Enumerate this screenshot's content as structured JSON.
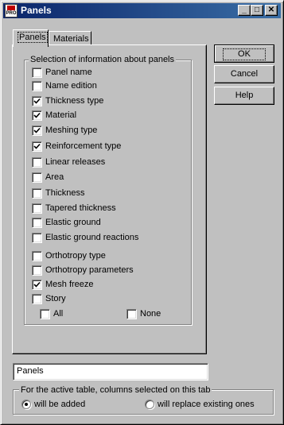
{
  "window": {
    "title": "Panels",
    "app_icon_text": "PRO",
    "minimize_glyph": "_",
    "maximize_glyph": "□",
    "close_glyph": "✕"
  },
  "tabs": [
    {
      "label": "Panels",
      "active": true
    },
    {
      "label": "Materials",
      "active": false
    }
  ],
  "selection_group": {
    "label": "Selection of information about panels",
    "items": [
      {
        "label": "Panel name",
        "checked": false
      },
      {
        "label": "Name edition",
        "checked": false
      },
      {
        "label": "Thickness type",
        "checked": true
      },
      {
        "label": "Material",
        "checked": true
      },
      {
        "label": "Meshing type",
        "checked": true
      },
      {
        "label": "Reinforcement type",
        "checked": true
      },
      {
        "label": "Linear releases",
        "checked": false
      },
      {
        "label": "Area",
        "checked": false
      },
      {
        "label": "Thickness",
        "checked": false
      },
      {
        "label": "Tapered thickness",
        "checked": false
      },
      {
        "label": "Elastic ground",
        "checked": false
      },
      {
        "label": "Elastic ground reactions",
        "checked": false
      },
      {
        "label": "Orthotropy type",
        "checked": false
      },
      {
        "label": "Orthotropy parameters",
        "checked": false
      },
      {
        "label": "Mesh freeze",
        "checked": true
      },
      {
        "label": "Story",
        "checked": false
      }
    ],
    "all_label": "All",
    "none_label": "None"
  },
  "buttons": {
    "ok": "OK",
    "cancel": "Cancel",
    "help": "Help"
  },
  "table_name_field": {
    "value": "Panels"
  },
  "columns_group": {
    "label": "For the active table, columns selected on this tab",
    "options": [
      {
        "label": "will be added",
        "selected": true
      },
      {
        "label": "will replace existing ones",
        "selected": false
      }
    ]
  }
}
